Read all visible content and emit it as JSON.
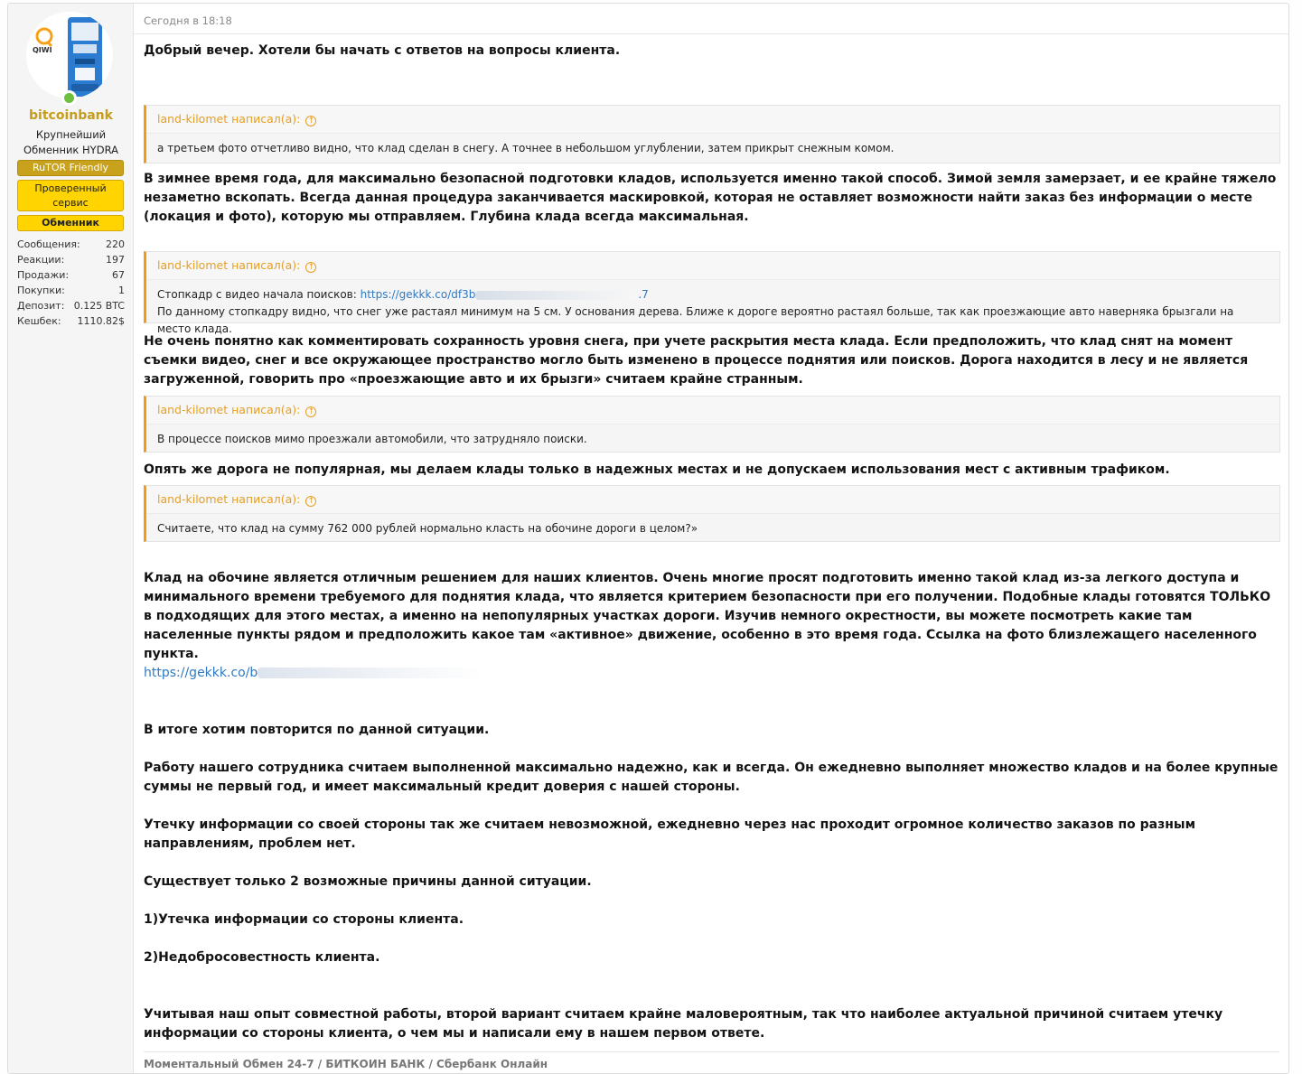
{
  "user": {
    "username": "bitcoinbank",
    "title_line1": "Крупнейший",
    "title_line2": "Обменник HYDRA",
    "banners": [
      "RuTOR Friendly",
      "Проверенный сервис",
      "Обменник"
    ],
    "stats": [
      {
        "label": "Сообщения:",
        "value": "220"
      },
      {
        "label": "Реакции:",
        "value": "197"
      },
      {
        "label": "Продажи:",
        "value": "67"
      },
      {
        "label": "Покупки:",
        "value": "1"
      },
      {
        "label": "Депозит:",
        "value": "0.125 BTC"
      },
      {
        "label": "Кешбек:",
        "value": "1110.82$"
      }
    ],
    "avatar_icon": "qiwi-terminal-icon",
    "status": "online"
  },
  "post": {
    "time": "Сегодня в 18:18",
    "p1": "Добрый вечер. Хотели бы начать с ответов на вопросы клиента.",
    "quote_author": "land-kilomet написал(а):",
    "q1": "а третьем фото отчетливо видно, что клад сделан в снегу. А точнее в небольшом углублении, затем прикрыт снежным комом.",
    "p2": "В зимнее время года, для максимально безопасной подготовки кладов, используется именно такой способ. Зимой земля замерзает, и ее крайне тяжело незаметно вскопать. Всегда данная процедура заканчивается маскировкой, которая не оставляет возможности найти заказ без информации о месте (локация и фото), которую мы отправляем. Глубина клада всегда максимальная.",
    "q2_prefix": "Стопкадр с видео начала поисков: ",
    "q2_link": "https://gekkk.co/df3b",
    "q2_link_end": ".7",
    "q2_line2": "По данному стопкадру видно, что снег уже растаял минимум на 5 см. У основания дерева. Ближе к дороге вероятно растаял больше, так как проезжающие авто наверняка брызгали на место клада.",
    "p3": "Не очень понятно как комментировать сохранность уровня снега, при учете раскрытия места клада. Если предположить, что клад снят на момент съемки видео, снег и все окружающее пространство могло быть изменено в процессе поднятия или поисков. Дорога находится в лесу и не является загруженной, говорить про «проезжающие авто и их брызги» считаем крайне странным.",
    "q3": "В процессе поисков мимо проезжали автомобили, что затрудняло поиски.",
    "p4": "Опять же дорога не популярная, мы делаем клады только в надежных местах и не допускаем использования мест с активным трафиком.",
    "q4": "Считаете, что клад на сумму 762 000 рублей нормально класть на обочине дороги в целом?»",
    "p5": "Клад на обочине является отличным решением для наших клиентов. Очень многие просят подготовить именно такой клад из-за легкого доступа и минимального времени требуемого для поднятия клада, что является критерием безопасности при его получении. Подобные клады готовятся ТОЛЬКО в подходящих для этого местах, а именно на непопулярных участках дороги. Изучив немного окрестности, вы можете посмотреть какие там населенные пункты рядом и предположить какое там «активное» движение, особенно в это время года. Ссылка на фото близлежащего населенного пункта.",
    "link": "https://gekkk.co/b",
    "p6": "В итоге хотим повторится по данной ситуации.",
    "p7": "Работу нашего сотрудника считаем выполненной максимально надежно, как и всегда. Он ежедневно выполняет множество кладов и на более крупные суммы не первый год, и имеет максимальный кредит доверия с нашей стороны.",
    "p8": "Утечку информации со своей стороны так же считаем невозможной, ежедневно через нас проходит огромное количество заказов по разным направлениям, проблем нет.",
    "p9": "Существует только 2 возможные причины данной ситуации.",
    "p10": "1)Утечка информации со стороны клиента.",
    "p11": "2)Недобросовестность клиента.",
    "p12": "Учитывая наш опыт совместной работы, второй вариант считаем крайне маловероятным, так что наиболее актуальной причиной считаем утечку информации со стороны клиента, о чем мы и написали ему в нашем первом ответе.",
    "signature": "Моментальный Обмен 24-7 / БИТКОИН БАНК / Сбербанк Онлайн"
  },
  "colors": {
    "accent": "#f39c12",
    "username": "#c59c1b",
    "link": "#2f7ac3",
    "banner_yellow": "#ffd400"
  }
}
